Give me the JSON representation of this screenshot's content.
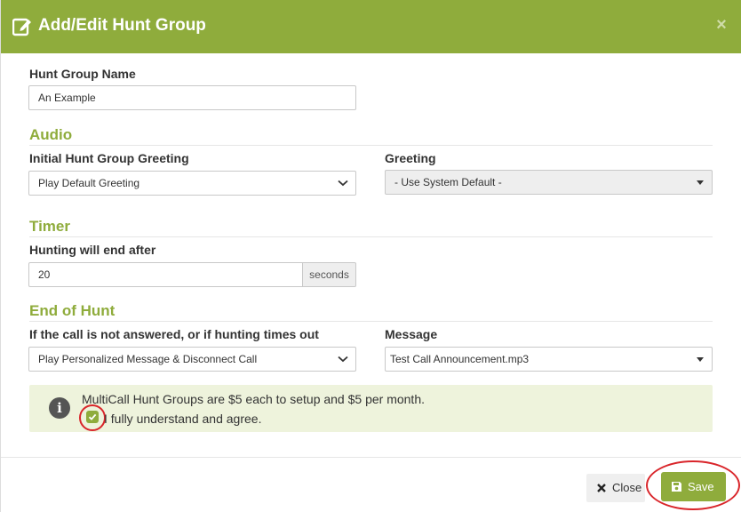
{
  "header": {
    "title": "Add/Edit Hunt Group",
    "title_icon": "edit-icon",
    "close_glyph": "×"
  },
  "hunt_group_name": {
    "label": "Hunt Group Name",
    "value": "An Example"
  },
  "audio": {
    "section_title": "Audio",
    "initial_greeting_label": "Initial Hunt Group Greeting",
    "initial_greeting_value": "Play Default Greeting",
    "greeting_label": "Greeting",
    "greeting_value": "- Use System Default -"
  },
  "timer": {
    "section_title": "Timer",
    "label": "Hunting will end after",
    "value": "20",
    "unit": "seconds"
  },
  "end_of_hunt": {
    "section_title": "End of Hunt",
    "action_label": "If the call is not answered, or if hunting times out",
    "action_value": "Play Personalized Message & Disconnect Call",
    "message_label": "Message",
    "message_value": "Test Call Announcement.mp3"
  },
  "notice": {
    "icon": "info-icon",
    "icon_glyph": "i",
    "text": "MultiCall Hunt Groups are $5 each to setup and $5 per month.",
    "agree_label": "I fully understand and agree.",
    "agree_checked": true
  },
  "footer": {
    "close_label": "Close",
    "save_label": "Save"
  },
  "colors": {
    "accent": "#8fac3c",
    "notice_bg": "#eef3dc",
    "annotation": "#d9252a"
  }
}
